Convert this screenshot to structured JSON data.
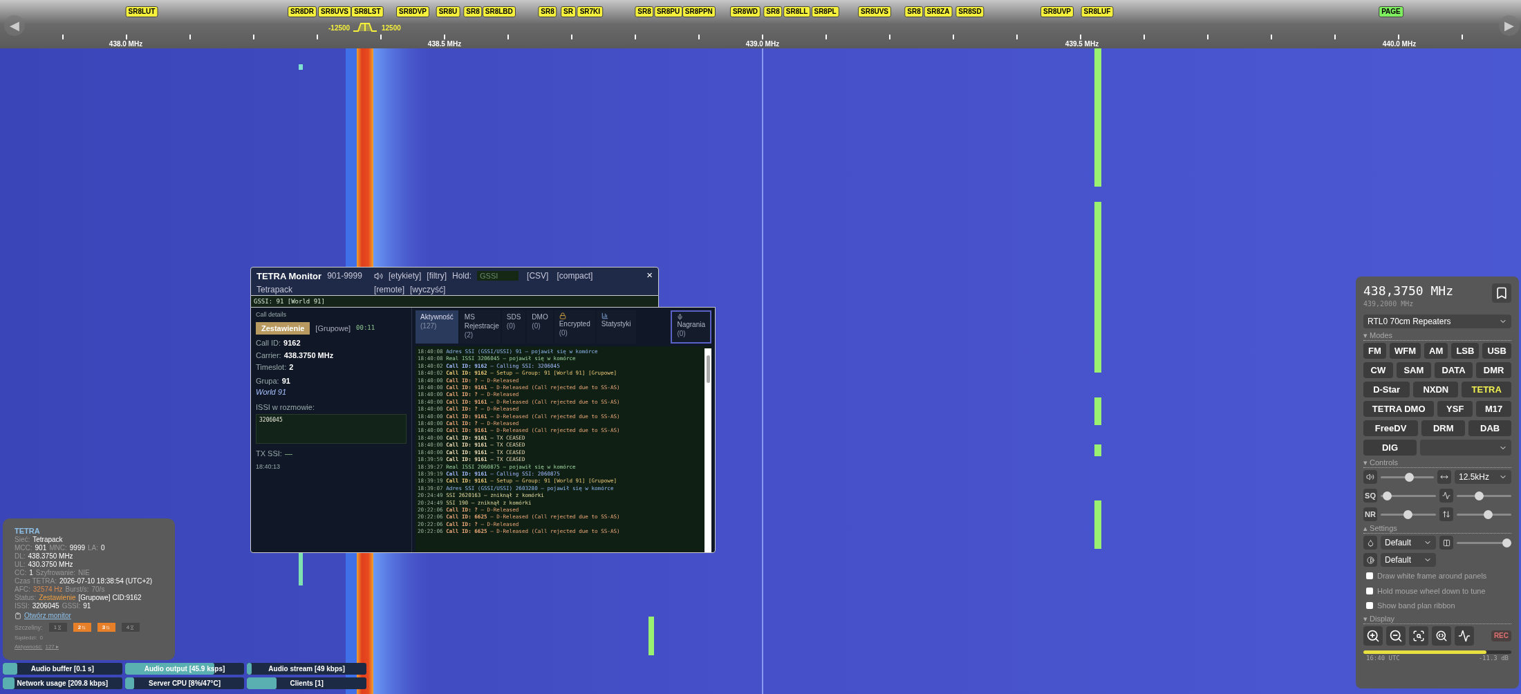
{
  "scale": {
    "back": "◀",
    "forward": "▶",
    "frequencies": [
      "438.0 MHz",
      "438.5 MHz",
      "439.0 MHz",
      "439.5 MHz",
      "440.0 MHz"
    ],
    "passband": {
      "low": "-12500",
      "high": "12500"
    },
    "markers": [
      {
        "label": "SR8LUT",
        "color": "#f5f03c"
      },
      {
        "label": "SR8DR",
        "color": "#f5f03c"
      },
      {
        "label": "SR8UVS",
        "color": "#f5f03c"
      },
      {
        "label": "SR8LST",
        "color": "#f5f03c"
      },
      {
        "label": "SR8DVP",
        "color": "#f5f03c"
      },
      {
        "label": "SR8U",
        "color": "#f5f03c"
      },
      {
        "label": "SR8",
        "color": "#f5f03c"
      },
      {
        "label": "SR8LBD",
        "color": "#f5f03c"
      },
      {
        "label": "SR8",
        "color": "#f5f03c"
      },
      {
        "label": "SR",
        "color": "#f5f03c"
      },
      {
        "label": "SR7KI",
        "color": "#f5f03c"
      },
      {
        "label": "SR8",
        "color": "#f5f03c"
      },
      {
        "label": "SR8PU",
        "color": "#f5f03c"
      },
      {
        "label": "SR8PPN",
        "color": "#f5f03c"
      },
      {
        "label": "SR8WD",
        "color": "#f5f03c"
      },
      {
        "label": "SR8",
        "color": "#f5f03c"
      },
      {
        "label": "SR8LL",
        "color": "#f5f03c"
      },
      {
        "label": "SR8PL",
        "color": "#f5f03c"
      },
      {
        "label": "SR8UVS",
        "color": "#f5f03c"
      },
      {
        "label": "SR8",
        "color": "#f5f03c"
      },
      {
        "label": "SR8ZA",
        "color": "#f5f03c"
      },
      {
        "label": "SR8SD",
        "color": "#f5f03c"
      },
      {
        "label": "SR8UVP",
        "color": "#f5f03c"
      },
      {
        "label": "SR8LUF",
        "color": "#f5f03c"
      },
      {
        "label": "PAGE",
        "color": "#7ef060"
      }
    ]
  },
  "tetra_monitor": {
    "title": "TETRA Monitor",
    "range": "901-9999",
    "network": "Tetrapack",
    "links": [
      "[etykiety]",
      "[filtry]"
    ],
    "hold_label": "Hold:",
    "hold_placeholder": "GSSI",
    "links_right": [
      "[CSV]",
      "[compact]"
    ],
    "links_second": [
      "[remote]",
      "[wyczyść]"
    ],
    "close": "×",
    "gssi_bar": "GSSI: 91 [World 91]",
    "call_details": {
      "heading": "Call details",
      "status": "Zestawienie",
      "call_type": "[Grupowe]",
      "duration": "00:11",
      "fields": [
        {
          "label": "Call ID:",
          "value": "9162"
        },
        {
          "label": "Carrier:",
          "value": "438.3750 MHz"
        },
        {
          "label": "Timeslot:",
          "value": "2"
        }
      ],
      "group": {
        "label": "Grupa:",
        "value": "91",
        "name": "World 91"
      },
      "issi_label": "ISSI w rozmowie:",
      "issi_list": "3206045",
      "tx_label": "TX SSI:",
      "tx_value": "—",
      "time": "18:40:13"
    },
    "tabs": [
      {
        "label": "Aktywność",
        "count": "(127)",
        "selected": true
      },
      {
        "label": "MS Rejestracje",
        "count": "(2)",
        "selected": false
      },
      {
        "label": "SDS",
        "count": "(0)",
        "selected": false
      },
      {
        "label": "DMO",
        "count": "(0)",
        "selected": false
      },
      {
        "label": "Encrypted",
        "count": "(0)",
        "selected": false
      },
      {
        "label": "Statystyki",
        "selected": false
      }
    ],
    "recordings_tab": {
      "label": "Nagrania",
      "count": "(0)",
      "selected": false
    },
    "log": [
      {
        "time": "18:40:08",
        "kind": "register",
        "text": "Adres SSI (GSSI/USSI) 91 — pojawił się w komórce"
      },
      {
        "time": "18:40:08",
        "kind": "real",
        "text": "Real ISSI 3206045 — pojawił się w komórce"
      },
      {
        "time": "18:40:02",
        "kind": "calling",
        "text": "**Call ID: 9162** — Calling SSI: 3206045"
      },
      {
        "time": "18:40:02",
        "kind": "setup",
        "text": "**Call ID: 9162** — Setup — Group: 91 [World 91] [Grupowe]"
      },
      {
        "time": "18:40:00",
        "kind": "released",
        "text": "**Call ID: ?** — D-Released"
      },
      {
        "time": "18:40:00",
        "kind": "released",
        "text": "**Call ID: 9161** — D-Released (Call rejected due to SS-AS)"
      },
      {
        "time": "18:40:00",
        "kind": "released",
        "text": "**Call ID: ?** — D-Released"
      },
      {
        "time": "18:40:00",
        "kind": "released",
        "text": "**Call ID: 9161** — D-Released (Call rejected due to SS-AS)"
      },
      {
        "time": "18:40:00",
        "kind": "released",
        "text": "**Call ID: ?** — D-Released"
      },
      {
        "time": "18:40:00",
        "kind": "released",
        "text": "**Call ID: 9161** — D-Released (Call rejected due to SS-AS)"
      },
      {
        "time": "18:40:00",
        "kind": "released",
        "text": "**Call ID: ?** — D-Released"
      },
      {
        "time": "18:40:00",
        "kind": "released",
        "text": "**Call ID: 9161** — D-Released (Call rejected due to SS-AS)"
      },
      {
        "time": "18:40:00",
        "kind": "ceased",
        "text": "**Call ID: 9161** — TX CEASED"
      },
      {
        "time": "18:40:00",
        "kind": "ceased",
        "text": "**Call ID: 9161** — TX CEASED"
      },
      {
        "time": "18:40:00",
        "kind": "ceased",
        "text": "**Call ID: 9161** — TX CEASED"
      },
      {
        "time": "18:39:59",
        "kind": "ceased",
        "text": "**Call ID: 9161** — TX CEASED"
      },
      {
        "time": "18:39:27",
        "kind": "real",
        "text": "Real ISSI 2060875 — pojawił się w komórce"
      },
      {
        "time": "18:39:19",
        "kind": "calling",
        "text": "**Call ID: 9161** — Calling SSI: 2060875"
      },
      {
        "time": "18:39:19",
        "kind": "setup",
        "text": "**Call ID: 9161** — Setup — Group: 91 [World 91] [Grupowe]"
      },
      {
        "time": "18:39:07",
        "kind": "register",
        "text": "Adres SSI (GSSI/USSI) 2603280 — pojawił się w komórce"
      },
      {
        "time": "20:24:49",
        "kind": "gone",
        "text": "SSI 2620163 — zniknął z komórki"
      },
      {
        "time": "20:24:49",
        "kind": "gone",
        "text": "SSI 190 — zniknął z komórki"
      },
      {
        "time": "20:22:06",
        "kind": "released",
        "text": "**Call ID: ?** — D-Released"
      },
      {
        "time": "20:22:06",
        "kind": "released",
        "text": "**Call ID: 6625** — D-Released (Call rejected due to SS-AS)"
      },
      {
        "time": "20:22:06",
        "kind": "released",
        "text": "**Call ID: ?** — D-Released"
      },
      {
        "time": "20:22:06",
        "kind": "released",
        "text": "**Call ID: 6625** — D-Released (Call rejected due to SS-AS)"
      }
    ]
  },
  "tetra_status": {
    "title": "TETRA",
    "lines": [
      [
        {
          "text": "Sieć:",
          "kind": "label"
        },
        {
          "text": "Tetrapack",
          "kind": "value"
        }
      ],
      [
        {
          "text": "MCC:",
          "kind": "label"
        },
        {
          "text": "901",
          "kind": "value"
        },
        {
          "text": "MNC:",
          "kind": "label"
        },
        {
          "text": "9999",
          "kind": "value"
        },
        {
          "text": "LA:",
          "kind": "label"
        },
        {
          "text": "0",
          "kind": "value"
        }
      ],
      [
        {
          "text": "DL:",
          "kind": "label"
        },
        {
          "text": "438.3750 MHz",
          "kind": "value"
        }
      ],
      [
        {
          "text": "UL:",
          "kind": "label"
        },
        {
          "text": "430.3750 MHz",
          "kind": "value"
        }
      ],
      [
        {
          "text": "CC:",
          "kind": "label"
        },
        {
          "text": "1",
          "kind": "value"
        },
        {
          "text": "Szyfrowanie:",
          "kind": "label"
        },
        {
          "text": "NIE",
          "kind": "label"
        }
      ],
      [
        {
          "text": "Czas TETRA:",
          "kind": "label"
        },
        {
          "text": "2026-07-10 18:38:54 (UTC+2)",
          "kind": "value"
        }
      ],
      [
        {
          "text": "AFC:",
          "kind": "label"
        },
        {
          "text": "32574 Hz",
          "kind": "warn"
        },
        {
          "text": "Burst/s:",
          "kind": "label"
        },
        {
          "text": "70/s",
          "kind": "label"
        }
      ],
      [
        {
          "text": "Status:",
          "kind": "label"
        },
        {
          "text": "Zestawienie",
          "kind": "status"
        },
        {
          "text": "[Grupowe] CID:9162",
          "kind": "value"
        }
      ],
      [
        {
          "text": "ISSI:",
          "kind": "label"
        },
        {
          "text": "3206045",
          "kind": "value"
        },
        {
          "text": "GSSI:",
          "kind": "label"
        },
        {
          "text": "91",
          "kind": "value"
        }
      ]
    ],
    "monitor_link": "Otwórz monitor",
    "slots_label": "Szczeliny:",
    "slots": [
      {
        "label": "1",
        "active": false
      },
      {
        "label": "2",
        "active": true
      },
      {
        "label": "3",
        "active": true
      },
      {
        "label": "4",
        "active": false
      }
    ],
    "neighbours_label": "Sąsiedzi:",
    "neighbours": "0",
    "activity_label": "Aktywność:",
    "activity": "127 ▸"
  },
  "status_bars": [
    {
      "label": "Audio buffer [0.1 s]",
      "level": 0.12
    },
    {
      "label": "Audio output [45.9 ksps]",
      "level": 0.75
    },
    {
      "label": "Audio stream [49 kbps]",
      "level": 0.04
    },
    {
      "label": "Network usage [209.8 kbps]",
      "level": 0.1
    },
    {
      "label": "Server CPU [8%/47°C]",
      "level": 0.08
    },
    {
      "label": "Clients [1]",
      "level": 0.25
    }
  ],
  "receiver": {
    "frequency": "438,3750 MHz",
    "center_frequency": "439,2000 MHz",
    "profile": "RTL0 70cm Repeaters",
    "modes_heading": "▾ Modes",
    "mode_rows": [
      [
        {
          "label": "FM",
          "selected": false
        },
        {
          "label": "WFM",
          "selected": false
        },
        {
          "label": "AM",
          "selected": false
        },
        {
          "label": "LSB",
          "selected": false
        },
        {
          "label": "USB",
          "selected": false
        }
      ],
      [
        {
          "label": "CW",
          "selected": false
        },
        {
          "label": "SAM",
          "selected": false
        },
        {
          "label": "DATA",
          "selected": false
        },
        {
          "label": "DMR",
          "selected": false
        }
      ],
      [
        {
          "label": "D-Star",
          "selected": false
        },
        {
          "label": "NXDN",
          "selected": false
        },
        {
          "label": "TETRA",
          "selected": true
        }
      ],
      [
        {
          "label": "TETRA DMO",
          "selected": false
        },
        {
          "label": "YSF",
          "selected": false
        },
        {
          "label": "M17",
          "selected": false
        }
      ],
      [
        {
          "label": "FreeDV",
          "selected": false
        },
        {
          "label": "DRM",
          "selected": false
        },
        {
          "label": "DAB",
          "selected": false
        }
      ],
      [
        {
          "label": "DIG",
          "selected": false
        }
      ]
    ],
    "controls_heading": "▾ Controls",
    "volume": {
      "level": 0.55
    },
    "bandwidth": "12.5kHz",
    "squelch": {
      "label": "SQ",
      "level": 0.04
    },
    "squelch_auto": {
      "level": 0.4
    },
    "nr": {
      "label": "NR",
      "level": 0.5
    },
    "nr_level": {
      "level": 0.6
    },
    "settings_heading": "▴ Settings",
    "theme": "Default",
    "opacity": {
      "level": 1
    },
    "contrast": "Default",
    "options": [
      {
        "label": "Draw white frame around panels",
        "checked": false
      },
      {
        "label": "Hold mouse wheel down to tune",
        "checked": false
      },
      {
        "label": "Show band plan ribbon",
        "checked": false
      }
    ],
    "display_heading": "▾ Display",
    "rec": "REC",
    "meter": {
      "level": 0.83
    },
    "time": "16:40 UTC",
    "db": "-11.3 dB"
  }
}
